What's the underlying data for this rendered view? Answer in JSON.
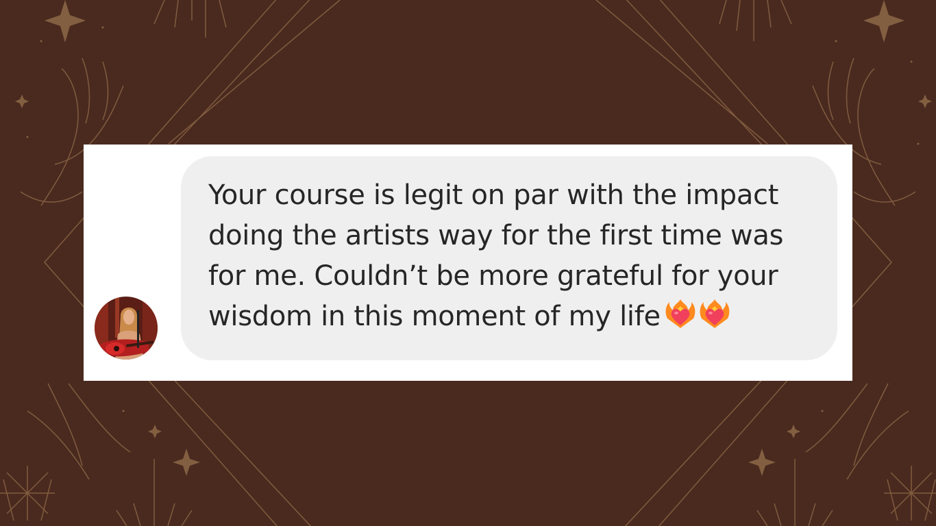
{
  "background": {
    "color": "#4a2a1f",
    "ornament_color": "#8a6545",
    "icons": [
      "sparkle-icon",
      "hand-icon",
      "star-icon",
      "sunburst-icon"
    ]
  },
  "message": {
    "text": "Your course is legit on par with the impact doing the artists way for the first time was for me. Couldn’t be more grateful for your wisdom in this moment of my life",
    "emojis": [
      "heart-on-fire-icon",
      "heart-on-fire-icon"
    ],
    "bubble_color": "#efefef",
    "text_color": "#262626"
  },
  "sender": {
    "avatar_icon": "avatar"
  }
}
